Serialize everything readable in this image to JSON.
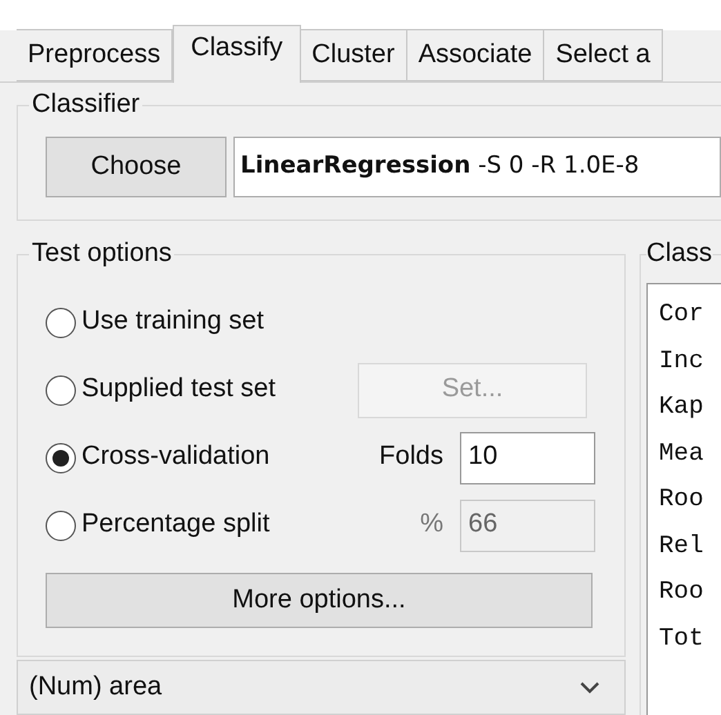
{
  "tabs": [
    {
      "label": "Preprocess",
      "selected": false
    },
    {
      "label": "Classify",
      "selected": true
    },
    {
      "label": "Cluster",
      "selected": false
    },
    {
      "label": "Associate",
      "selected": false
    },
    {
      "label": "Select a",
      "selected": false
    }
  ],
  "classifier": {
    "title": "Classifier",
    "choose_button": "Choose",
    "value": "**LinearRegression** -S 0 -R 1.0E-8"
  },
  "test_options": {
    "title": "Test options",
    "options": [
      {
        "kind": "plain",
        "label": "Use training set",
        "selected": false
      },
      {
        "kind": "button",
        "label": "Supplied test set",
        "selected": false,
        "button": "Set...",
        "disabled": true
      },
      {
        "kind": "field",
        "label": "Cross-validation",
        "selected": true,
        "field_label": "Folds",
        "value": "10",
        "disabled": false
      },
      {
        "kind": "field",
        "label": "Percentage split",
        "selected": false,
        "field_label": "%",
        "value": "66",
        "disabled": true
      }
    ],
    "more_button": "More options..."
  },
  "class_attribute": {
    "value": "(Num) area"
  },
  "output": {
    "title": "Class",
    "lines": [
      "Cor",
      "Inc",
      "Kap",
      "Mea",
      "Roo",
      "Rel",
      "Roo",
      "Tot"
    ]
  }
}
